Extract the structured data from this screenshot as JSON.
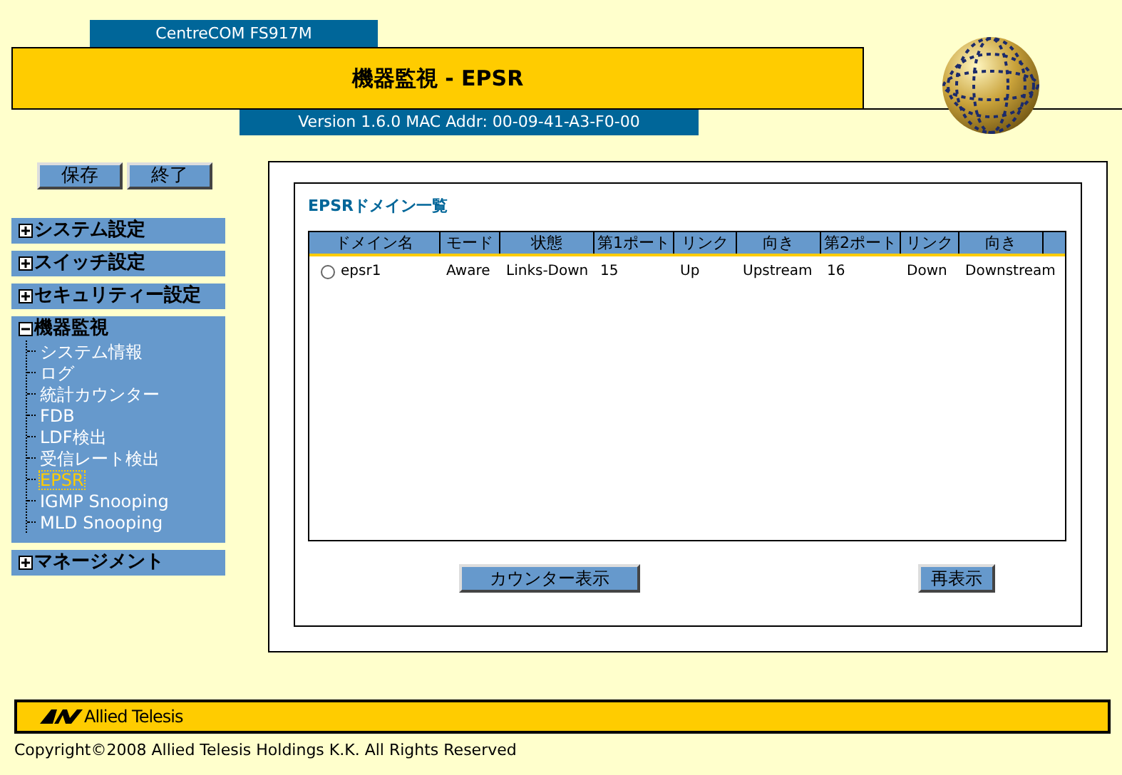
{
  "header": {
    "product": "CentreCOM FS917M",
    "title": "機器監視 - EPSR",
    "version": "Version 1.6.0 MAC Addr: 00-09-41-A3-F0-00"
  },
  "sidebar": {
    "buttons": [
      "保存",
      "終了"
    ],
    "menu": [
      {
        "label": "システム設定",
        "expanded": false
      },
      {
        "label": "スイッチ設定",
        "expanded": false
      },
      {
        "label": "セキュリティー設定",
        "expanded": false
      },
      {
        "label": "機器監視",
        "expanded": true,
        "children": [
          {
            "label": "システム情報",
            "selected": false
          },
          {
            "label": "ログ",
            "selected": false
          },
          {
            "label": "統計カウンター",
            "selected": false
          },
          {
            "label": "FDB",
            "selected": false
          },
          {
            "label": "LDF検出",
            "selected": false
          },
          {
            "label": "受信レート検出",
            "selected": false
          },
          {
            "label": "EPSR",
            "selected": true
          },
          {
            "label": "IGMP Snooping",
            "selected": false
          },
          {
            "label": "MLD Snooping",
            "selected": false
          }
        ]
      },
      {
        "label": "マネージメント",
        "expanded": false
      }
    ]
  },
  "panel": {
    "title": "EPSRドメイン一覧",
    "table": {
      "columns": [
        "ドメイン名",
        "モード",
        "状態",
        "第1ポート",
        "リンク",
        "向き",
        "第2ポート",
        "リンク",
        "向き"
      ],
      "rows": [
        {
          "selected": false,
          "cells": [
            "epsr1",
            "Aware",
            "Links-Down",
            "15",
            "Up",
            "Upstream",
            "16",
            "Down",
            "Downstream"
          ]
        }
      ]
    },
    "buttons": [
      "カウンター表示",
      "再表示"
    ]
  },
  "footer": {
    "logo": "Allied Telesis",
    "copyright": "Copyright©2008 Allied Telesis Holdings K.K. All Rights Reserved"
  }
}
